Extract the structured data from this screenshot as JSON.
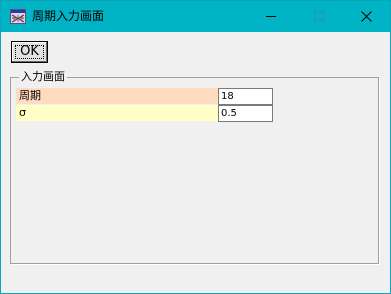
{
  "window": {
    "title": "周期入力画面",
    "icon": "dialog-app-icon",
    "controls": {
      "minimize_icon": "minimize-icon",
      "maximize_icon": "maximize-icon",
      "close_icon": "close-icon"
    }
  },
  "toolbar": {
    "ok_label": "OK"
  },
  "group": {
    "legend": "入力画面",
    "rows": [
      {
        "label": "周期",
        "value": "18",
        "label_bg": "#ffdbc0"
      },
      {
        "label": "σ",
        "value": "0.5",
        "label_bg": "#ffffc6"
      }
    ]
  },
  "colors": {
    "titlebar": "#00b4c6",
    "window_bg": "#f0f0f0"
  }
}
